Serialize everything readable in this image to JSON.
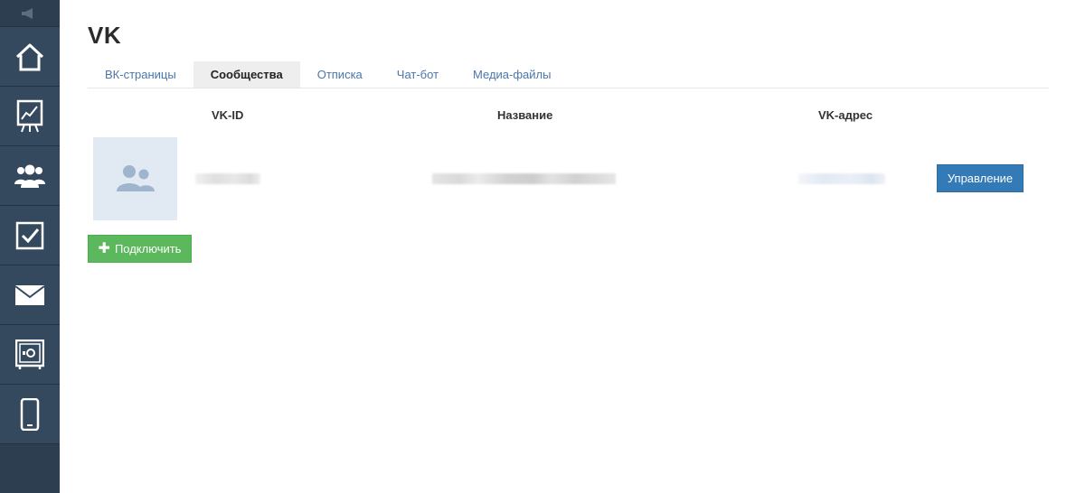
{
  "page": {
    "title": "VK"
  },
  "sidebar": {
    "items": [
      {
        "name": "home-icon"
      },
      {
        "name": "chart-icon"
      },
      {
        "name": "users-icon"
      },
      {
        "name": "checkbox-icon"
      },
      {
        "name": "mail-icon"
      },
      {
        "name": "safe-icon"
      },
      {
        "name": "mobile-icon"
      }
    ]
  },
  "tabs": [
    {
      "label": "ВК-страницы",
      "active": false
    },
    {
      "label": "Сообщества",
      "active": true
    },
    {
      "label": "Отписка",
      "active": false
    },
    {
      "label": "Чат-бот",
      "active": false
    },
    {
      "label": "Медиа-файлы",
      "active": false
    }
  ],
  "table": {
    "headers": {
      "vk_id": "VK-ID",
      "name": "Название",
      "address": "VK-адрес"
    },
    "rows": [
      {
        "manage_label": "Управление"
      }
    ]
  },
  "actions": {
    "connect_label": "Подключить"
  },
  "colors": {
    "sidebar": "#2c3e50",
    "accent_link": "#4a76a8",
    "primary_button": "#337ab7",
    "success_button": "#5cb85c",
    "avatar_bg": "#e1e9f2"
  }
}
